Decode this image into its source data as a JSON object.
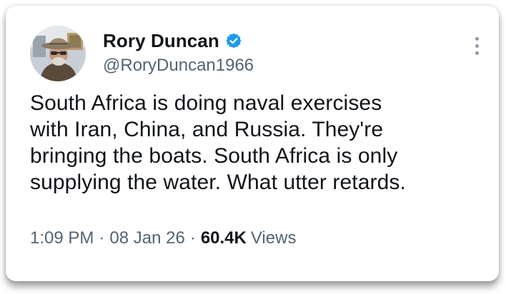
{
  "author": {
    "display_name": "Rory Duncan",
    "handle": "@RoryDuncan1966",
    "verified": true,
    "avatar_icon": "profile-photo-man-in-hat",
    "verified_badge_color": "#1d9bf0"
  },
  "tweet": {
    "text_lines": [
      "South Africa is doing naval exercises",
      "with Iran, China, and Russia. They're",
      "bringing the boats. South Africa is only",
      "supplying the water. What utter retards."
    ]
  },
  "meta": {
    "time": "1:09 PM",
    "separator": "·",
    "date": "08 Jan 26",
    "views_count": "60.4K",
    "views_label": "Views"
  },
  "menu": {
    "icon": "more-vertical-icon"
  }
}
